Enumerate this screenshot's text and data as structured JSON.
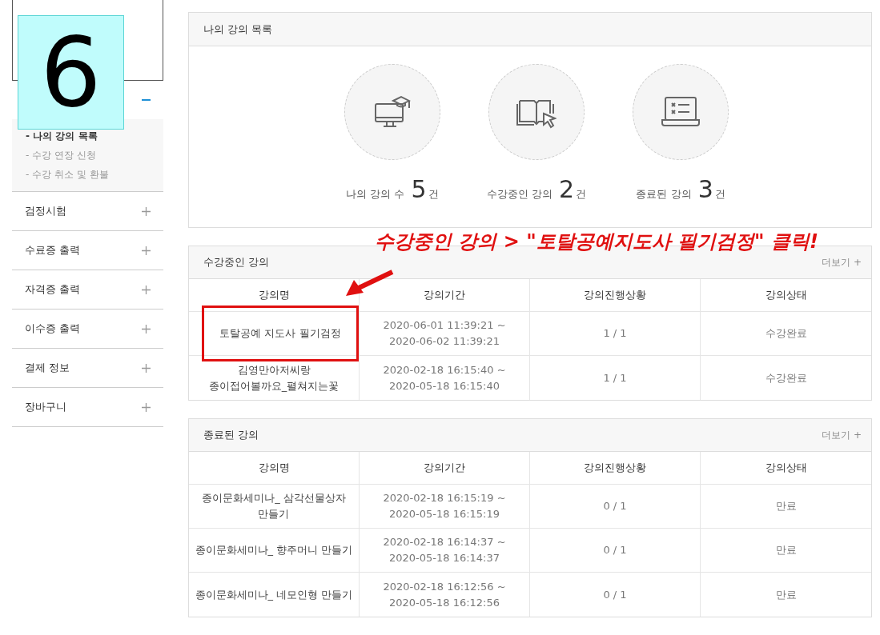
{
  "step_badge": "6",
  "sidebar": {
    "items": [
      {
        "expanded": true,
        "children": [
          {
            "label": "- 나의 강의 목록",
            "selected": true
          },
          {
            "label": "- 수강 연장 신청",
            "selected": false
          },
          {
            "label": "- 수강 취소 및 환불",
            "selected": false
          }
        ]
      },
      {
        "label": "검정시험",
        "expanded": false
      },
      {
        "label": "수료증 출력",
        "expanded": false
      },
      {
        "label": "자격증 출력",
        "expanded": false
      },
      {
        "label": "이수증 출력",
        "expanded": false
      },
      {
        "label": "결제 정보",
        "expanded": false
      },
      {
        "label": "장바구니",
        "expanded": false
      }
    ]
  },
  "summary": {
    "title": "나의 강의 목록",
    "stats": [
      {
        "kind": "monitor",
        "label": "나의 강의 수",
        "count": "5",
        "unit": "건"
      },
      {
        "kind": "book",
        "label": "수강중인 강의",
        "count": "2",
        "unit": "건"
      },
      {
        "kind": "laptop",
        "label": "종료된 강의",
        "count": "3",
        "unit": "건"
      }
    ]
  },
  "annotation": {
    "text": "수강중인 강의 > \"토탈공예지도사 필기검정\" 클릭!"
  },
  "tables": [
    {
      "title": "수강중인 강의",
      "more": "더보기 +",
      "columns": [
        "강의명",
        "강의기간",
        "강의진행상황",
        "강의상태"
      ],
      "rows": [
        {
          "highlighted": true,
          "cells": [
            "토탈공예 지도사 필기검정",
            "2020-06-01 11:39:21 ~\n2020-06-02 11:39:21",
            "1 / 1",
            "수강완료"
          ]
        },
        {
          "highlighted": false,
          "cells": [
            "김영만아저씨랑\n종이접어볼까요_펼쳐지는꽃",
            "2020-02-18 16:15:40 ~\n2020-05-18 16:15:40",
            "1 / 1",
            "수강완료"
          ]
        }
      ]
    },
    {
      "title": "종료된 강의",
      "more": "더보기 +",
      "columns": [
        "강의명",
        "강의기간",
        "강의진행상황",
        "강의상태"
      ],
      "rows": [
        {
          "highlighted": false,
          "cells": [
            "종이문화세미나_ 삼각선물상자\n만들기",
            "2020-02-18 16:15:19 ~\n2020-05-18 16:15:19",
            "0 / 1",
            "만료"
          ]
        },
        {
          "highlighted": false,
          "cells": [
            "종이문화세미나_ 향주머니 만들기",
            "2020-02-18 16:14:37 ~\n2020-05-18 16:14:37",
            "0 / 1",
            "만료"
          ]
        },
        {
          "highlighted": false,
          "cells": [
            "종이문화세미나_ 네모인형 만들기",
            "2020-02-18 16:12:56 ~\n2020-05-18 16:12:56",
            "0 / 1",
            "만료"
          ]
        }
      ]
    }
  ]
}
